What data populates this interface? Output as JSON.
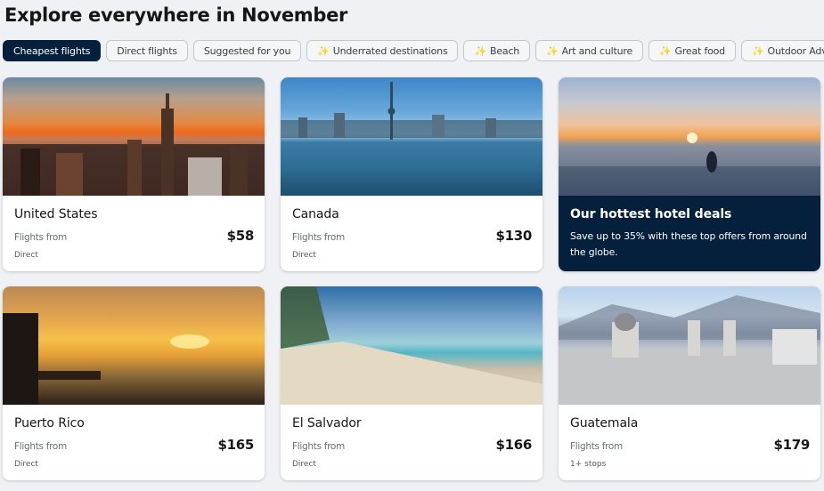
{
  "header": {
    "title": "Explore everywhere in November"
  },
  "filters": [
    {
      "label": "Cheapest flights",
      "active": true,
      "sparkle": false
    },
    {
      "label": "Direct flights",
      "active": false,
      "sparkle": false
    },
    {
      "label": "Suggested for you",
      "active": false,
      "sparkle": false
    },
    {
      "label": "Underrated destinations",
      "active": false,
      "sparkle": true
    },
    {
      "label": "Beach",
      "active": false,
      "sparkle": true
    },
    {
      "label": "Art and culture",
      "active": false,
      "sparkle": true
    },
    {
      "label": "Great food",
      "active": false,
      "sparkle": true
    },
    {
      "label": "Outdoor Adventures",
      "active": false,
      "sparkle": true
    }
  ],
  "sparkle_icon": "✨",
  "colors": {
    "brand_dark": "#05203c",
    "background": "#eff1f5",
    "sparkle": "#f5b731"
  },
  "destinations": [
    {
      "name": "United States",
      "flights_from": "Flights from",
      "price": "$58",
      "stops": "Direct",
      "image": "new-york-skyline-sunset"
    },
    {
      "name": "Canada",
      "flights_from": "Flights from",
      "price": "$130",
      "stops": "Direct",
      "image": "toronto-skyline-water"
    },
    {
      "name": "Puerto Rico",
      "flights_from": "Flights from",
      "price": "$165",
      "stops": "Direct",
      "image": "san-juan-sunset-fort"
    },
    {
      "name": "El Salvador",
      "flights_from": "Flights from",
      "price": "$166",
      "stops": "Direct",
      "image": "beach-shoreline"
    },
    {
      "name": "Guatemala",
      "flights_from": "Flights from",
      "price": "$179",
      "stops": "1+ stops",
      "image": "antigua-cathedral-mountains"
    }
  ],
  "promo": {
    "title": "Our hottest hotel deals",
    "description": "Save up to 35% with these top offers from around the globe.",
    "image": "infinity-pool-sunset"
  }
}
